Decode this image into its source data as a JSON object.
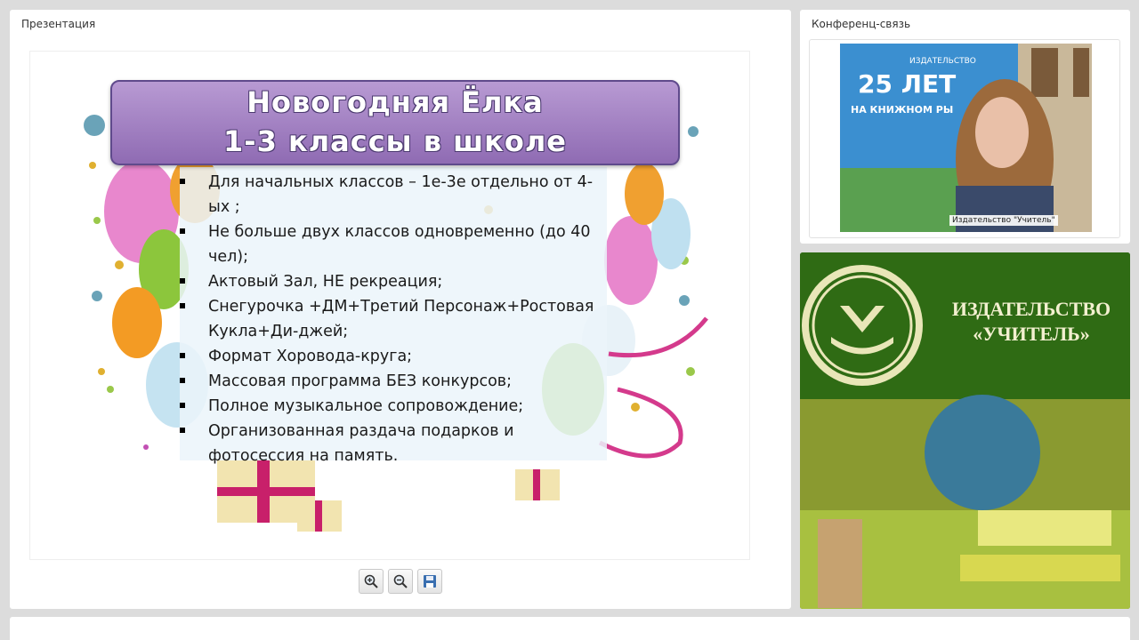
{
  "presentation": {
    "panel_title": "Презентация",
    "slide": {
      "title_line1": "Новогодняя Ёлка",
      "title_line2": "1-3 классы в школе",
      "bullets": [
        "Для начальных классов – 1е-3е отдельно от 4-ых ;",
        "Не больше двух классов одновременно (до 40 чел);",
        "Актовый Зал, НЕ рекреация;",
        "Снегурочка +ДМ+Третий Персонаж+Ростовая Кукла+Ди-джей;",
        "Формат Хоровода-круга;",
        "Массовая программа БЕЗ конкурсов;",
        "Полное музыкальное сопровождение;",
        "Организованная раздача подарков и фотосессия на память."
      ]
    },
    "toolbar": {
      "zoom_in_icon": "zoom-in-icon",
      "zoom_out_icon": "zoom-out-icon",
      "save_icon": "save-icon"
    }
  },
  "conference": {
    "panel_title": "Конференц-связь",
    "video_label": "Издательство \"Учитель\"",
    "banner_big": "25 ЛЕТ",
    "banner_small": "НА КНИЖНОМ РЫ",
    "banner_brand": "ИЗДАТЕЛЬСТВО"
  },
  "ad": {
    "publisher_line1": "ИЗДАТЕЛЬСТВО",
    "publisher_line2": "«УЧИТЕЛЬ»"
  },
  "colors": {
    "ad_green": "#2f6b14",
    "title_purple": "#9a78bf"
  }
}
